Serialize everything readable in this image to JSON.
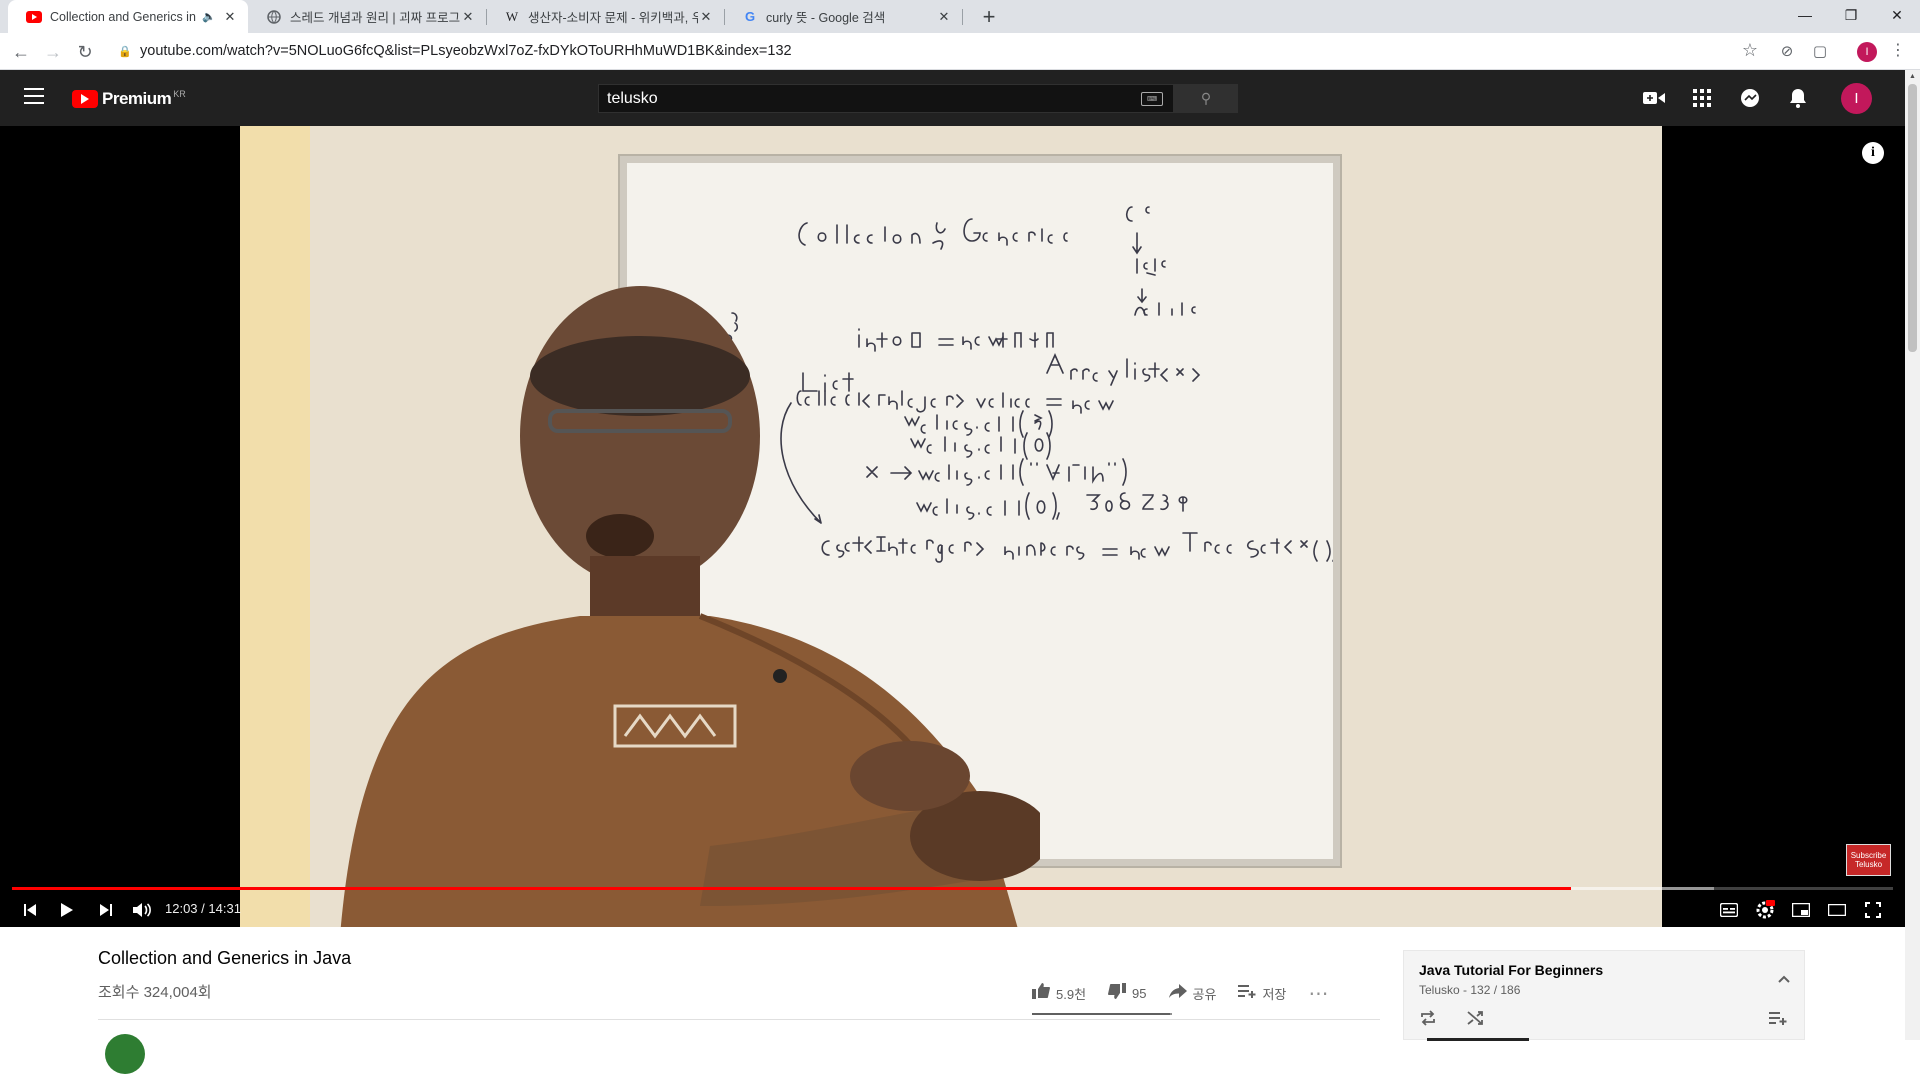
{
  "browser": {
    "tabs": [
      {
        "title": "Collection and Generics in Java",
        "favicon": "youtube-icon",
        "active": true,
        "audio": true
      },
      {
        "title": "스레드 개념과 원리 | 괴짜 프로그래머",
        "favicon": "globe-icon",
        "active": false,
        "audio": false
      },
      {
        "title": "생산자-소비자 문제 - 위키백과, 우리 모두의 백과사전",
        "favicon": "wikipedia-icon",
        "active": false,
        "audio": false
      },
      {
        "title": "curly 뜻 - Google 검색",
        "favicon": "google-icon",
        "active": false,
        "audio": false
      }
    ],
    "url": "youtube.com/watch?v=5NOLuoG6fcQ&list=PLsyeobzWxl7oZ-fxDYkOToURHhMuWD1BK&index=132",
    "profile_initial": "I"
  },
  "youtube": {
    "logo_text": "Premium",
    "region": "KR",
    "search_value": "telusko",
    "avatar_initial": "I"
  },
  "player": {
    "time_current": "12:03",
    "time_total": "14:31",
    "progress_played": 0.829,
    "progress_loaded": 0.905,
    "watermark_text": "Subscribe Telusko",
    "info_label": "i"
  },
  "video": {
    "title": "Collection and Generics in Java",
    "views": "조회수 324,004회",
    "likes": "5.9천",
    "dislikes": "95",
    "share_label": "공유",
    "save_label": "저장",
    "like_ratio": 0.984
  },
  "playlist": {
    "title": "Java Tutorial For Beginners",
    "subtitle": "Telusko - 132 / 186"
  }
}
